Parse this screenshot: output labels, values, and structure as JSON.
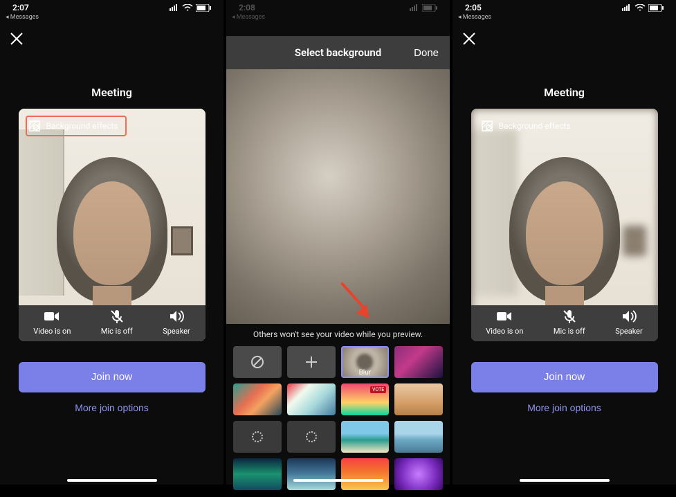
{
  "phone1": {
    "time": "2:07",
    "messages_back": "◂ Messages",
    "heading": "Meeting",
    "bg_effects_label": "Background effects",
    "video_label": "Video is on",
    "mic_label": "Mic is off",
    "speaker_label": "Speaker",
    "join_label": "Join now",
    "more_label": "More join options"
  },
  "phone2": {
    "time": "2:08",
    "messages_back": "◂ Messages",
    "header_title": "Select background",
    "done_label": "Done",
    "hint": "Others won't see your video while you preview.",
    "blur_label": "Blur"
  },
  "phone3": {
    "time": "2:05",
    "messages_back": "◂ Messages",
    "heading": "Meeting",
    "bg_effects_label": "Background effects",
    "video_label": "Video is on",
    "mic_label": "Mic is off",
    "speaker_label": "Speaker",
    "join_label": "Join now",
    "more_label": "More join options"
  }
}
